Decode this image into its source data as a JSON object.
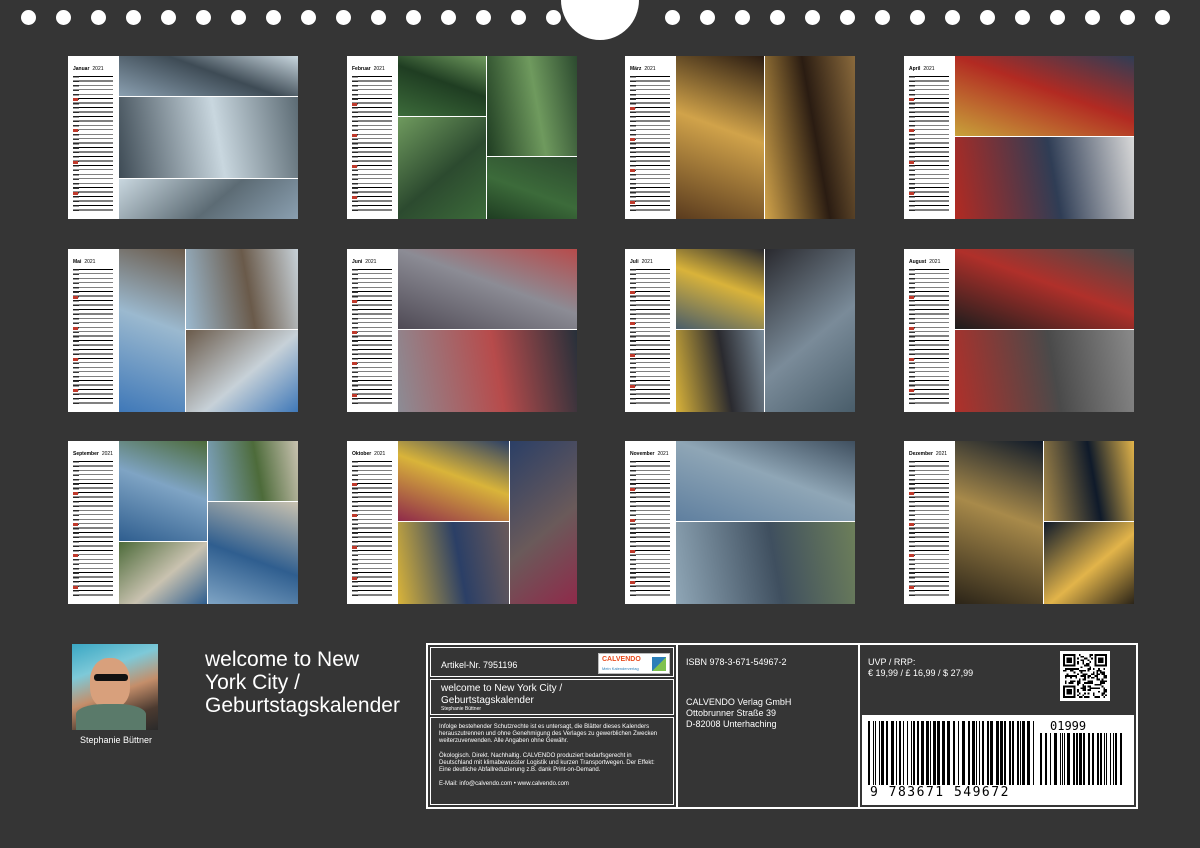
{
  "calendar_year": "2021",
  "months": [
    {
      "name": "Januar"
    },
    {
      "name": "Februar"
    },
    {
      "name": "März"
    },
    {
      "name": "April"
    },
    {
      "name": "Mai"
    },
    {
      "name": "Juni"
    },
    {
      "name": "Juli"
    },
    {
      "name": "August"
    },
    {
      "name": "September"
    },
    {
      "name": "Oktober"
    },
    {
      "name": "November"
    },
    {
      "name": "Dezember"
    }
  ],
  "author": {
    "name": "Stephanie Büttner"
  },
  "calendar_title": "welcome to New York City / Geburtstagskalender",
  "info": {
    "article_label": "Artikel-Nr. 7951196",
    "logo": {
      "word": "CALVENDO",
      "sub": "Mein Kalenderverlag"
    },
    "title": "welcome to New York City / Geburtstagskalender",
    "author_small": "Stephanie Büttner",
    "notice": "Infolge bestehender Schutzrechte ist es untersagt, die Blätter dieses Kalenders herauszutrennen und ohne Genehmigung des Verlages zu gewerblichen Zwecken weiterzuverwenden. Alle Angaben ohne Gewähr.",
    "eco": "Ökologisch. Direkt. Nachhaltig. CALVENDO produziert bedarfsgerecht in Deutschland mit klimabewusster Logistik und kurzen Transportwegen. Der Effekt: Eine deutliche Abfallreduzierung z.B. dank Print-on-Demand.",
    "contact": "E-Mail: info@calvendo.com • www.calvendo.com",
    "isbn": "ISBN 978-3-671-54967-2",
    "publisher_line1": "CALVENDO Verlag GmbH",
    "publisher_line2": "Ottobrunner Straße 39",
    "publisher_line3": "D-82008 Unterhaching",
    "uvp_label": "UVP / RRP:",
    "prices": "€ 19,99 / £ 16,99 / $ 27,99",
    "barcode_number": "9 783671 549672",
    "addon_number": "01999"
  }
}
